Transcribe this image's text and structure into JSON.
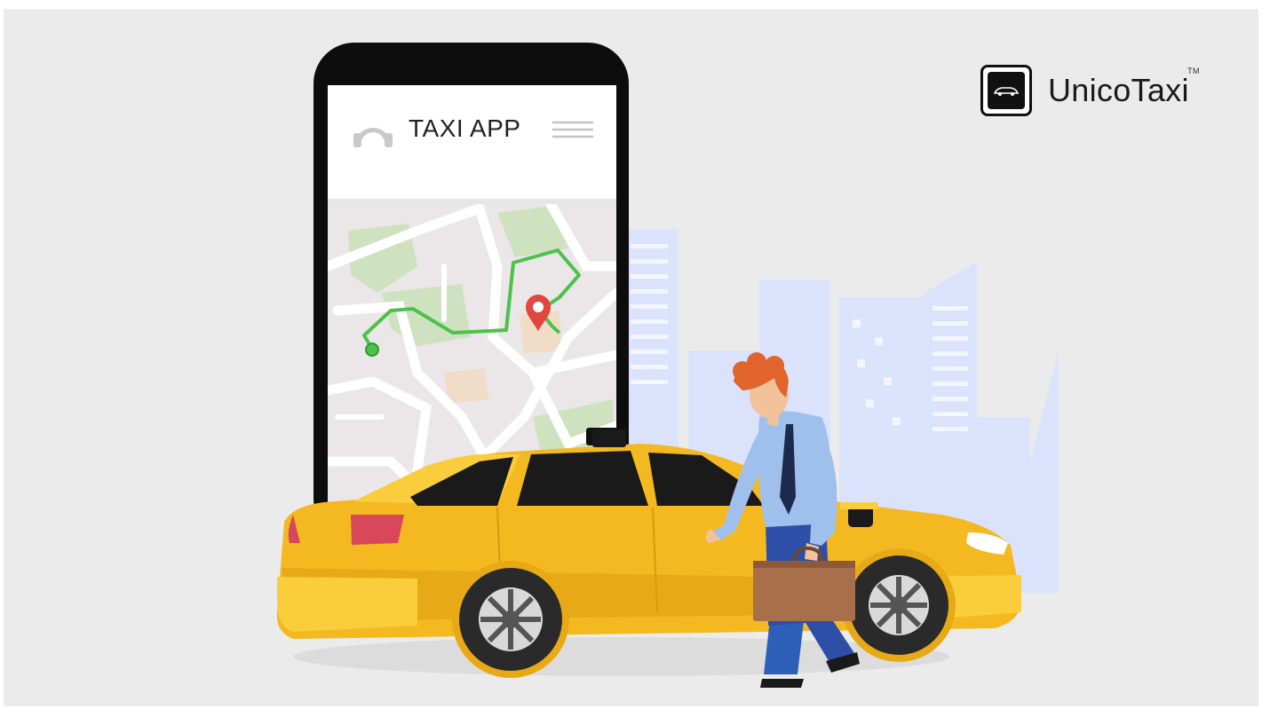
{
  "brand": {
    "name": "UnicoTaxi",
    "trademark": "TM",
    "logo_icon": "car-icon"
  },
  "app": {
    "title": "TAXI APP",
    "avatar_icon": "user-icon",
    "menu_icon": "hamburger-menu-icon"
  },
  "map": {
    "destination_icon": "location-pin-icon",
    "origin_icon": "origin-dot-icon"
  },
  "colors": {
    "background": "#ebebeb",
    "taxi_yellow": "#f4b920",
    "route_green": "#4bc24b",
    "pin_red": "#e0473f",
    "city_blue": "#dbe2fb",
    "map_green": "#cfe2c0"
  }
}
